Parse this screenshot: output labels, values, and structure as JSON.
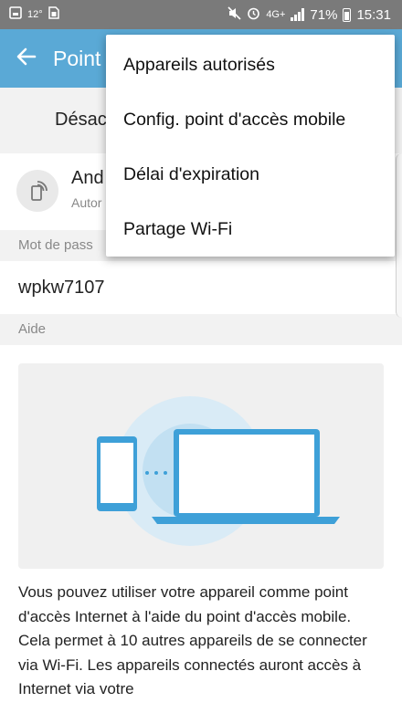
{
  "status_bar": {
    "temperature": "12°",
    "network": "4G+",
    "battery": "71%",
    "time": "15:31"
  },
  "app_bar": {
    "title": "Point"
  },
  "toggle": {
    "label": "Désac"
  },
  "device": {
    "name": "And",
    "subtitle": "Autor"
  },
  "password_section": {
    "header": "Mot de pass",
    "value": "wpkw7107"
  },
  "help_section": {
    "header": "Aide",
    "text": "Vous pouvez utiliser votre appareil comme point d'accès Internet à l'aide du point d'accès mobile. Cela permet à 10 autres appareils de se connecter via Wi-Fi. Les appareils connectés auront accès à Internet via votre"
  },
  "menu": {
    "items": [
      {
        "label": "Appareils autorisés"
      },
      {
        "label": "Config. point d'accès mobile"
      },
      {
        "label": "Délai d'expiration"
      },
      {
        "label": "Partage Wi-Fi"
      }
    ]
  },
  "colors": {
    "app_bar": "#5aa9d6",
    "status_bar": "#7a7a7a",
    "illustration_accent": "#3ea0d8"
  }
}
